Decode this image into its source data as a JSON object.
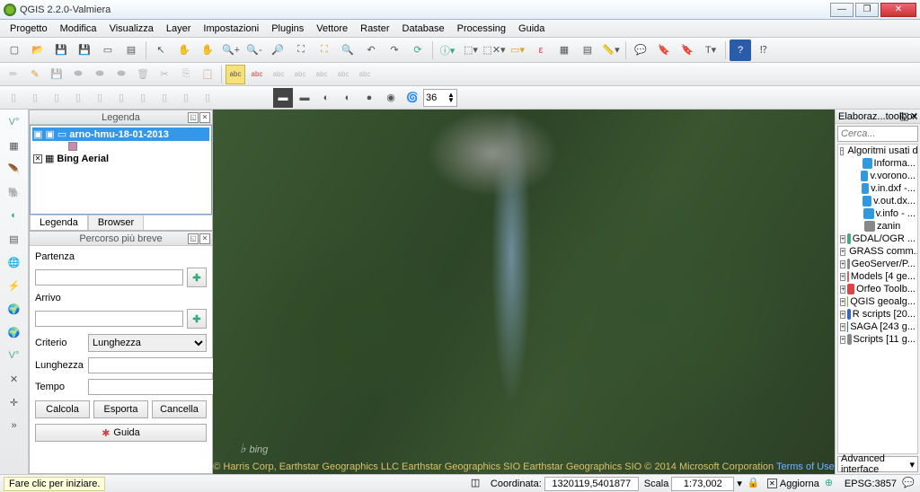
{
  "title": "QGIS 2.2.0-Valmiera",
  "menu": [
    "Progetto",
    "Modifica",
    "Visualizza",
    "Layer",
    "Impostazioni",
    "Plugins",
    "Vettore",
    "Raster",
    "Database",
    "Processing",
    "Guida"
  ],
  "spin_value": "36",
  "legend": {
    "panel_title": "Legenda",
    "layers": [
      {
        "name": "arno-hmu-18-01-2013",
        "selected": true,
        "sub_color": "#c58bb0"
      },
      {
        "name": "Bing Aerial",
        "selected": false
      }
    ],
    "tabs": {
      "legenda": "Legenda",
      "browser": "Browser"
    }
  },
  "route": {
    "panel_title": "Percorso più breve",
    "partenza_label": "Partenza",
    "arrivo_label": "Arrivo",
    "criterio_label": "Criterio",
    "criterio_value": "Lunghezza",
    "lunghezza_label": "Lunghezza",
    "tempo_label": "Tempo",
    "calcola": "Calcola",
    "esporta": "Esporta",
    "cancella": "Cancella",
    "guida": "Guida"
  },
  "canvas": {
    "bing": "bing",
    "attrib_text": "© Harris Corp, Earthstar Geographics LLC Earthstar Geographics SIO Earthstar Geographics SIO © 2014 Microsoft Corporation ",
    "attrib_link": "Terms of Use"
  },
  "toolbox": {
    "title": "Elaboraz...toolbox",
    "search_placeholder": "Cerca...",
    "nodes": [
      {
        "label": "Algoritmi usati di ...",
        "exp": "-",
        "indent": 0,
        "color": "#333",
        "icon": "#7aa"
      },
      {
        "label": "Informa...",
        "indent": 1,
        "color": "#333",
        "icon": "#39d"
      },
      {
        "label": "v.vorono...",
        "indent": 1,
        "color": "#333",
        "icon": "#39d"
      },
      {
        "label": "v.in.dxf -...",
        "indent": 1,
        "color": "#333",
        "icon": "#39d"
      },
      {
        "label": "v.out.dx...",
        "indent": 1,
        "color": "#333",
        "icon": "#39d"
      },
      {
        "label": "v.info - ...",
        "indent": 1,
        "color": "#333",
        "icon": "#39d"
      },
      {
        "label": "zanin",
        "indent": 1,
        "color": "#333",
        "icon": "#888"
      },
      {
        "label": "GDAL/OGR ...",
        "exp": "+",
        "indent": 0,
        "icon": "#4a8"
      },
      {
        "label": "GRASS comm...",
        "exp": "+",
        "indent": 0,
        "icon": "#6b4"
      },
      {
        "label": "GeoServer/P...",
        "exp": "+",
        "indent": 0,
        "icon": "#888"
      },
      {
        "label": "Models [4 ge...",
        "exp": "+",
        "indent": 0,
        "icon": "#c66"
      },
      {
        "label": "Orfeo Toolb...",
        "exp": "+",
        "indent": 0,
        "icon": "#d44"
      },
      {
        "label": "QGIS geoalg...",
        "exp": "+",
        "indent": 0,
        "icon": "#6b3"
      },
      {
        "label": "R scripts [20...",
        "exp": "+",
        "indent": 0,
        "icon": "#36c"
      },
      {
        "label": "SAGA [243 g...",
        "exp": "+",
        "indent": 0,
        "icon": "#36c"
      },
      {
        "label": "Scripts [11 g...",
        "exp": "+",
        "indent": 0,
        "icon": "#888"
      }
    ],
    "advanced": "Advanced interface"
  },
  "status": {
    "hint": "Fare clic per iniziare.",
    "coord_label": "Coordinata:",
    "coord_value": "1320119,5401877",
    "scala_label": "Scala",
    "scala_value": "1:73,002",
    "aggiorna": "Aggiorna",
    "epsg": "EPSG:3857"
  }
}
